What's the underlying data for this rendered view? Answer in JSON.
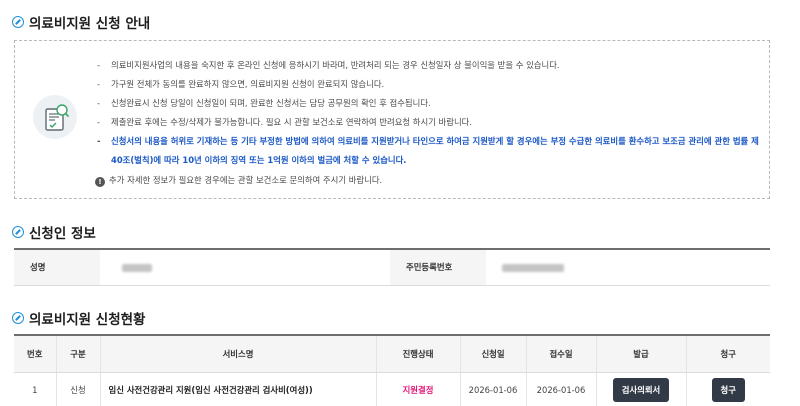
{
  "guide": {
    "title": "의료비지원 신청 안내",
    "items": [
      "의료비지원사업의 내용을 숙지한 후 온라인 신청에 응하시기 바라며, 반려처리 되는 경우 신청일자 상 불이익을 받을 수 있습니다.",
      "가구원 전체가 동의를 완료하지 않으면, 의료비지원 신청이 완료되지 않습니다.",
      "신청완료시 신청 당일이 신청일이 되며, 완료한 신청서는 담당 공무원의 확인 후 접수됩니다.",
      "제출완료 후에는 수정/삭제가 불가능합니다. 필요 시 관할 보건소로 연락하여 반려요청 하시기 바랍니다."
    ],
    "warning": "신청서의 내용을 허위로 기재하는 등 기타 부정한 방법에 의하여 의료비를 지원받거나 타인으로 하여금 지원받게 할 경우에는 부정 수급한 의료비를 환수하고 보조금 관리에 관한 법률 제40조(벌칙)에 따라 10년 이하의 징역 또는 1억원 이하의 벌금에 처할 수 있습니다.",
    "note": "추가 자세한 정보가 필요한 경우에는 관할 보건소로 문의하여 주시기 바랍니다.",
    "icon": "document-search-icon"
  },
  "applicant": {
    "title": "신청인 정보",
    "name_label": "성명",
    "rrn_label": "주민등록번호"
  },
  "status": {
    "title": "의료비지원 신청현황",
    "headers": [
      "번호",
      "구분",
      "서비스명",
      "진행상태",
      "신청일",
      "접수일",
      "발급",
      "청구"
    ],
    "rows": [
      {
        "no": "1",
        "type": "신청",
        "service": "임신 사전건강관리 지원(임신 사전건강관리 검사비(여성))",
        "state": "지원결정",
        "applied": "2026-01-06",
        "received": "2026-01-06",
        "issue_button": "검사의뢰서",
        "claim_button": "청구"
      }
    ]
  },
  "colors": {
    "accent": "#1f8fd9",
    "warning_text": "#1b58c5",
    "state_text": "#e6197a",
    "button_bg": "#333a47"
  }
}
